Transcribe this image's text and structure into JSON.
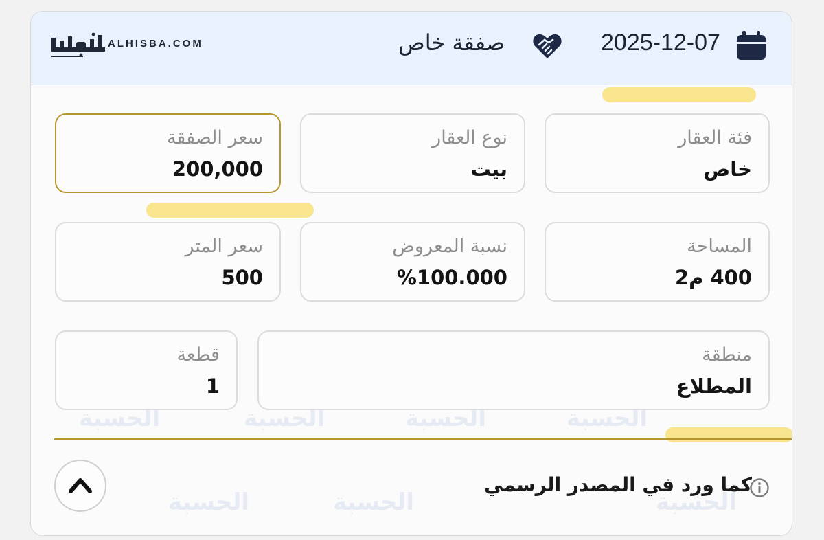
{
  "header": {
    "logo_ar": "الحسبة",
    "logo_en": "ALHISBA.COM",
    "deal_type": "صفقة خاص",
    "date": "2025-12-07",
    "icons": {
      "deal": "handshake-heart-icon",
      "date": "calendar-icon"
    }
  },
  "fields": {
    "price": {
      "label": "سعر الصفقة",
      "value": "200,000"
    },
    "property_type": {
      "label": "نوع العقار",
      "value": "بيت"
    },
    "property_category": {
      "label": "فئة العقار",
      "value": "خاص"
    },
    "price_per_meter": {
      "label": "سعر المتر",
      "value": "500"
    },
    "offered_ratio": {
      "label": "نسبة المعروض",
      "value": "%100.000"
    },
    "area": {
      "label": "المساحة",
      "value": "400 م2"
    },
    "plot": {
      "label": "قطعة",
      "value": "1"
    },
    "region": {
      "label": "منطقة",
      "value": "المطلاع"
    }
  },
  "footer": {
    "source_note": "كما ورد في المصدر الرسمي",
    "icons": {
      "info": "info-icon",
      "collapse": "chevron-up-icon"
    }
  },
  "watermark_text": "الحسبة",
  "colors": {
    "header_bg": "#e8f1fc",
    "accent_gold": "#b8962e",
    "highlight_yellow": "#f7e17a",
    "icon_navy": "#1e2a45"
  }
}
